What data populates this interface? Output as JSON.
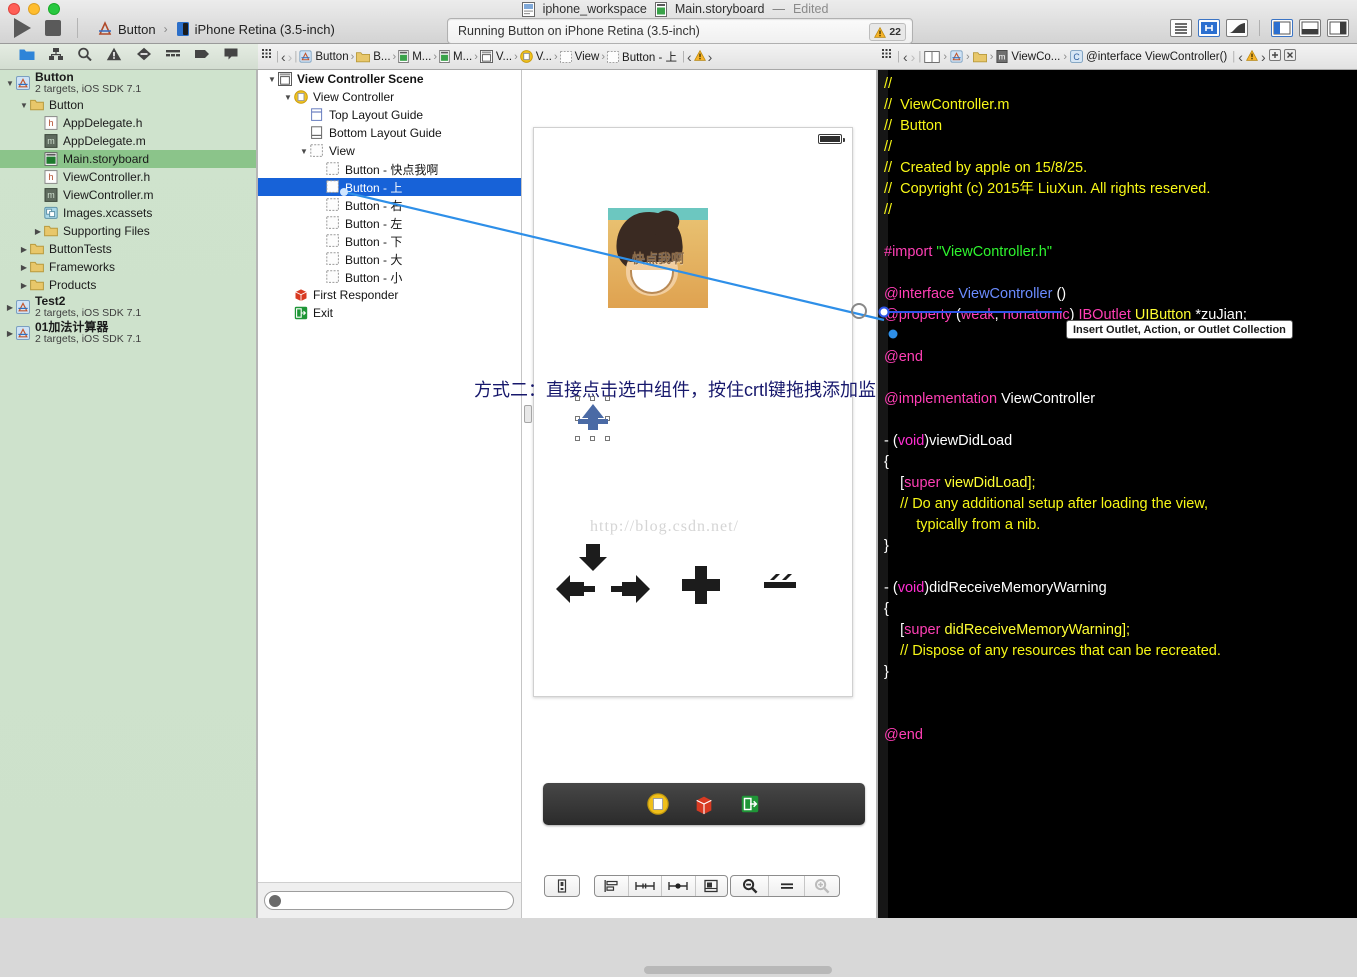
{
  "window": {
    "document_title": "Main.storyboard",
    "workspace_title": "iphone_workspace",
    "edited_label": "Edited",
    "dash": "—",
    "traffic_lights": [
      "close",
      "minimize",
      "zoom"
    ]
  },
  "toolbar": {
    "run_label": "Run",
    "stop_label": "Stop",
    "scheme_project": "Button",
    "scheme_chevron": "›",
    "scheme_destination": "iPhone Retina (3.5-inch)",
    "status_text": "Running Button on iPhone Retina (3.5-inch)",
    "warning_count": "22",
    "editor_buttons": [
      "standard-editor",
      "assistant-editor",
      "version-editor"
    ],
    "view_buttons": [
      "navigator-toggle",
      "debug-toggle",
      "utilities-toggle"
    ],
    "assistant_selected": true,
    "navigator_selected": true
  },
  "navigator": {
    "tabs": [
      "project-navigator",
      "symbol-navigator",
      "find-navigator",
      "issue-navigator",
      "test-navigator",
      "debug-navigator",
      "breakpoint-navigator",
      "log-navigator"
    ],
    "selected_tab": "project-navigator",
    "filter_placeholder": "",
    "tree": [
      {
        "label": "Button",
        "sub": "2 targets, iOS SDK 7.1",
        "icon": "project-icon",
        "depth": 0,
        "twisty": "open",
        "group": true
      },
      {
        "label": "Button",
        "sub": "",
        "icon": "folder-icon",
        "depth": 1,
        "twisty": "open"
      },
      {
        "label": "AppDelegate.h",
        "sub": "",
        "icon": "header-file-icon",
        "depth": 2,
        "twisty": "none"
      },
      {
        "label": "AppDelegate.m",
        "sub": "",
        "icon": "impl-file-icon",
        "depth": 2,
        "twisty": "none"
      },
      {
        "label": "Main.storyboard",
        "sub": "",
        "icon": "storyboard-icon",
        "depth": 2,
        "twisty": "none",
        "selected": true
      },
      {
        "label": "ViewController.h",
        "sub": "",
        "icon": "header-file-icon",
        "depth": 2,
        "twisty": "none"
      },
      {
        "label": "ViewController.m",
        "sub": "",
        "icon": "impl-file-icon",
        "depth": 2,
        "twisty": "none"
      },
      {
        "label": "Images.xcassets",
        "sub": "",
        "icon": "xcassets-icon",
        "depth": 2,
        "twisty": "none"
      },
      {
        "label": "Supporting Files",
        "sub": "",
        "icon": "folder-icon",
        "depth": 2,
        "twisty": "closed"
      },
      {
        "label": "ButtonTests",
        "sub": "",
        "icon": "folder-icon",
        "depth": 1,
        "twisty": "closed"
      },
      {
        "label": "Frameworks",
        "sub": "",
        "icon": "folder-icon",
        "depth": 1,
        "twisty": "closed"
      },
      {
        "label": "Products",
        "sub": "",
        "icon": "folder-icon",
        "depth": 1,
        "twisty": "closed"
      },
      {
        "label": "Test2",
        "sub": "2 targets, iOS SDK 7.1",
        "icon": "project-icon",
        "depth": 0,
        "twisty": "closed",
        "group": true
      },
      {
        "label": "01加法计算器",
        "sub": "2 targets, iOS SDK 7.1",
        "icon": "project-icon",
        "depth": 0,
        "twisty": "closed",
        "group": true
      }
    ]
  },
  "jumpbar_left": [
    {
      "label": "",
      "icon": "grid-icon"
    },
    {
      "label": "",
      "icon": "back-arrow-icon"
    },
    {
      "label": "",
      "icon": "forward-arrow-icon"
    },
    {
      "label": "Button",
      "icon": "project-icon"
    },
    {
      "label": "B...",
      "icon": "folder-icon"
    },
    {
      "label": "M...",
      "icon": "storyboard-icon"
    },
    {
      "label": "M...",
      "icon": "storyboard-icon"
    },
    {
      "label": "V...",
      "icon": "scene-icon"
    },
    {
      "label": "V...",
      "icon": "viewcontroller-icon"
    },
    {
      "label": "View",
      "icon": "view-icon"
    },
    {
      "label": "Button - 上",
      "icon": "view-icon"
    }
  ],
  "jumpbar_right": [
    {
      "label": "",
      "icon": "back-arrow-icon"
    },
    {
      "label": "",
      "icon": "forward-arrow-icon"
    },
    {
      "label": "",
      "icon": "assistant-mode-icon"
    },
    {
      "label": "",
      "icon": "project-icon"
    },
    {
      "label": "",
      "icon": "folder-icon"
    },
    {
      "label": "ViewCo...",
      "icon": "impl-file-icon"
    },
    {
      "label": "@interface ViewController()",
      "icon": "class-icon"
    }
  ],
  "outline": {
    "title": "View Controller Scene",
    "items": [
      {
        "label": "View Controller Scene",
        "icon": "scene-icon",
        "depth": 0,
        "twisty": "open",
        "bold": true
      },
      {
        "label": "View Controller",
        "icon": "viewcontroller-icon",
        "depth": 1,
        "twisty": "open"
      },
      {
        "label": "Top Layout Guide",
        "icon": "top-guide-icon",
        "depth": 2,
        "twisty": "none"
      },
      {
        "label": "Bottom Layout Guide",
        "icon": "bottom-guide-icon",
        "depth": 2,
        "twisty": "none"
      },
      {
        "label": "View",
        "icon": "view-icon",
        "depth": 2,
        "twisty": "open"
      },
      {
        "label": "Button - 快点我啊",
        "icon": "view-icon",
        "depth": 3,
        "twisty": "none"
      },
      {
        "label": "Button - 上",
        "icon": "view-icon",
        "depth": 3,
        "twisty": "none",
        "selected": true
      },
      {
        "label": "Button - 右",
        "icon": "view-icon",
        "depth": 3,
        "twisty": "none"
      },
      {
        "label": "Button - 左",
        "icon": "view-icon",
        "depth": 3,
        "twisty": "none"
      },
      {
        "label": "Button - 下",
        "icon": "view-icon",
        "depth": 3,
        "twisty": "none"
      },
      {
        "label": "Button - 大",
        "icon": "view-icon",
        "depth": 3,
        "twisty": "none"
      },
      {
        "label": "Button - 小",
        "icon": "view-icon",
        "depth": 3,
        "twisty": "none"
      },
      {
        "label": "First Responder",
        "icon": "first-responder-icon",
        "depth": 1,
        "twisty": "none"
      },
      {
        "label": "Exit",
        "icon": "exit-icon",
        "depth": 1,
        "twisty": "none"
      }
    ]
  },
  "canvas": {
    "image_button_label": "快点我啊",
    "annotation": "方式二：直接点击选中组件，按住crtl键拖拽添加监听方法",
    "watermark": "http://blog.csdn.net/",
    "dock_items": [
      "view-controller-icon",
      "first-responder-icon",
      "exit-icon"
    ],
    "bottom_toolbar": {
      "left_group": [
        "document-outline-toggle"
      ],
      "middle_group": [
        "align-icon",
        "pin-icon",
        "resolve-icon",
        "resize-icon"
      ],
      "right_group": [
        "zoom-out-icon",
        "zoom-reset-icon",
        "zoom-in-icon"
      ]
    }
  },
  "code": {
    "filename": "ViewController.m",
    "lines": [
      {
        "seg": [
          {
            "t": "//",
            "c": "c-com"
          }
        ]
      },
      {
        "seg": [
          {
            "t": "//  ViewController.m",
            "c": "c-com"
          }
        ]
      },
      {
        "seg": [
          {
            "t": "//  Button",
            "c": "c-com"
          }
        ]
      },
      {
        "seg": [
          {
            "t": "//",
            "c": "c-com"
          }
        ]
      },
      {
        "seg": [
          {
            "t": "//  Created by apple on 15/8/25.",
            "c": "c-com"
          }
        ]
      },
      {
        "seg": [
          {
            "t": "//  Copyright (c) 2015年 LiuXun. All rights reserved.",
            "c": "c-com"
          }
        ]
      },
      {
        "seg": [
          {
            "t": "//",
            "c": "c-com"
          }
        ]
      },
      {
        "seg": [
          {
            "t": "",
            "c": "c-white"
          }
        ]
      },
      {
        "seg": [
          {
            "t": "#import ",
            "c": "c-pink"
          },
          {
            "t": "\"ViewController.h\"",
            "c": "c-str"
          }
        ]
      },
      {
        "seg": [
          {
            "t": "",
            "c": "c-white"
          }
        ]
      },
      {
        "seg": [
          {
            "t": "@interface ",
            "c": "c-pink"
          },
          {
            "t": "ViewController ",
            "c": "c-type"
          },
          {
            "t": "()",
            "c": "c-white"
          }
        ]
      },
      {
        "seg": [
          {
            "t": "@property ",
            "c": "c-pink"
          },
          {
            "t": "(",
            "c": "c-white"
          },
          {
            "t": "weak",
            "c": "c-pink"
          },
          {
            "t": ", ",
            "c": "c-white"
          },
          {
            "t": "nonatomic",
            "c": "c-pink"
          },
          {
            "t": ") ",
            "c": "c-white"
          },
          {
            "t": "IBOutlet ",
            "c": "c-pink"
          },
          {
            "t": "UIButton ",
            "c": "c-yel"
          },
          {
            "t": "*zuJian;",
            "c": "c-white"
          }
        ]
      },
      {
        "seg": [
          {
            "t": "",
            "c": "c-white"
          }
        ]
      },
      {
        "seg": [
          {
            "t": "@end",
            "c": "c-pink"
          }
        ]
      },
      {
        "seg": [
          {
            "t": "",
            "c": "c-white"
          }
        ]
      },
      {
        "seg": [
          {
            "t": "@implementation ",
            "c": "c-pink"
          },
          {
            "t": "ViewController",
            "c": "c-white"
          }
        ]
      },
      {
        "seg": [
          {
            "t": "",
            "c": "c-white"
          }
        ]
      },
      {
        "seg": [
          {
            "t": "- (",
            "c": "c-white"
          },
          {
            "t": "void",
            "c": "c-kw"
          },
          {
            "t": ")viewDidLoad",
            "c": "c-white"
          }
        ]
      },
      {
        "seg": [
          {
            "t": "{",
            "c": "c-white"
          }
        ]
      },
      {
        "seg": [
          {
            "t": "    [",
            "c": "c-white"
          },
          {
            "t": "super ",
            "c": "c-pink"
          },
          {
            "t": "viewDidLoad];",
            "c": "c-yel"
          }
        ]
      },
      {
        "seg": [
          {
            "t": "    // Do any additional setup after loading the view,",
            "c": "c-com"
          }
        ]
      },
      {
        "seg": [
          {
            "t": "        typically from a nib.",
            "c": "c-com"
          }
        ]
      },
      {
        "seg": [
          {
            "t": "}",
            "c": "c-white"
          }
        ]
      },
      {
        "seg": [
          {
            "t": "",
            "c": "c-white"
          }
        ]
      },
      {
        "seg": [
          {
            "t": "- (",
            "c": "c-white"
          },
          {
            "t": "void",
            "c": "c-kw"
          },
          {
            "t": ")didReceiveMemoryWarning",
            "c": "c-white"
          }
        ]
      },
      {
        "seg": [
          {
            "t": "{",
            "c": "c-white"
          }
        ]
      },
      {
        "seg": [
          {
            "t": "    [",
            "c": "c-white"
          },
          {
            "t": "super ",
            "c": "c-pink"
          },
          {
            "t": "didReceiveMemoryWarning];",
            "c": "c-yel"
          }
        ]
      },
      {
        "seg": [
          {
            "t": "    // Dispose of any resources that can be recreated.",
            "c": "c-com"
          }
        ]
      },
      {
        "seg": [
          {
            "t": "}",
            "c": "c-white"
          }
        ]
      },
      {
        "seg": [
          {
            "t": "",
            "c": "c-white"
          }
        ]
      },
      {
        "seg": [
          {
            "t": "",
            "c": "c-white"
          }
        ]
      },
      {
        "seg": [
          {
            "t": "@end",
            "c": "c-pink"
          }
        ]
      }
    ]
  },
  "tooltip": {
    "text": "Insert Outlet, Action, or Outlet Collection"
  },
  "colors": {
    "selection_blue": "#1762d8",
    "navigator_green": "#cfe3cd",
    "navigator_selection": "#8bc48a",
    "connection_line": "#2e8fe8",
    "comment_yellow": "#f7f717",
    "keyword_pink": "#ff2ed1",
    "string_green": "#2ff52f",
    "type_blue": "#6b8cff"
  }
}
